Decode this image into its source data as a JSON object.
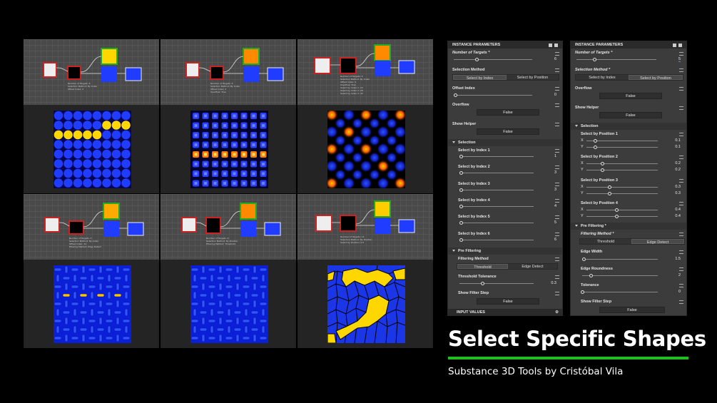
{
  "title": "Select Specific Shapes",
  "subtitle": "Substance 3D Tools by Cristóbal Vila",
  "colors": {
    "accent": "#1fbf1f",
    "blue": "#1f3cff",
    "yellow": "#ffd700",
    "orange": "#ff8a00"
  },
  "graph_notes": [
    "Number of Targets: 6\nSelection Method: By Index\nOffset Index: 0",
    "Number of Targets: 6\nSelection Method: By Index\nOffset Index: 0\nOverflow: True",
    "Number of Targets: 6\nSelection Method: By Index\nOffset Index: 0\nOverflow: True\nSelect by Index 1: 22\nSelect by Index 2: 28\nSelect by Index 3: 32",
    "Number of Targets: 5\nSelection Method: By Index\nOffset Index: 34\nFiltering Method: Edge Detect",
    "Number of Targets: 6\nSelection Method: By Position\nFiltering Method: Threshold",
    "Number of Targets: 14\nSelection Method: By Position\nSelect by Position: 0.5"
  ],
  "panel1": {
    "header": "INSTANCE PARAMETERS",
    "num_targets_label": "Number of Targets *",
    "num_targets_value": "6",
    "selection_method_label": "Selection Method",
    "sel_by_index": "Select by Index",
    "sel_by_position": "Select by Position",
    "offset_label": "Offset Index",
    "offset_value": "0",
    "overflow_label": "Overflow",
    "overflow_value": "False",
    "helper_label": "Show Helper",
    "helper_value": "False",
    "selection_section": "Selection",
    "index_items": [
      {
        "label": "Select by Index 1",
        "value": "1"
      },
      {
        "label": "Select by Index 2",
        "value": "3"
      },
      {
        "label": "Select by Index 3",
        "value": "3"
      },
      {
        "label": "Select by Index 4",
        "value": "4"
      },
      {
        "label": "Select by Index 5",
        "value": "5"
      },
      {
        "label": "Select by Index 6",
        "value": "6"
      }
    ],
    "prefilter_section": "Pre Filtering",
    "filtering_method_label": "Filtering Method",
    "threshold": "Threshold",
    "edge_detect": "Edge Detect",
    "threshold_tol_label": "Threshold Tolerance",
    "threshold_tol_value": "0.3",
    "filter_step_label": "Show Filter Step",
    "filter_step_value": "False",
    "footer": "INPUT VALUES"
  },
  "panel2": {
    "header": "INSTANCE PARAMETERS",
    "num_targets_label": "Number of Targets *",
    "num_targets_value": "5",
    "selection_method_label": "Selection Method *",
    "sel_by_index": "Select by Index",
    "sel_by_position": "Select by Position",
    "overflow_label": "Overflow",
    "overflow_value": "False",
    "helper_label": "Show Helper",
    "helper_value": "False",
    "selection_section": "Selection",
    "positions": [
      {
        "label": "Select by Position 1",
        "x": "0.1",
        "y": "0.1"
      },
      {
        "label": "Select by Position 2",
        "x": "0.2",
        "y": "0.2"
      },
      {
        "label": "Select by Position 3",
        "x": "0.3",
        "y": "0.3"
      },
      {
        "label": "Select by Position 4",
        "x": "0.4",
        "y": "0.4"
      }
    ],
    "x_label": "X",
    "y_label": "Y",
    "prefilter_section": "Pre Filtering *",
    "filtering_method_label": "Filtering Method *",
    "threshold": "Threshold",
    "edge_detect": "Edge Detect",
    "edge_width_label": "Edge Width",
    "edge_width_value": "1.5",
    "edge_round_label": "Edge Roundness",
    "edge_round_value": "2",
    "tolerance_label": "Tolerance",
    "tolerance_value": "0",
    "filter_step_label": "Show Filter Step",
    "filter_step_value": "False"
  }
}
